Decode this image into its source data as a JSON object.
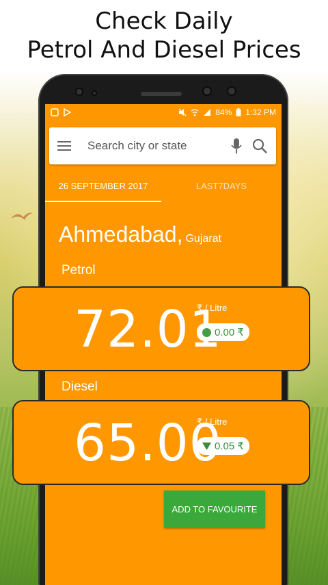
{
  "headline": {
    "line1": "Check Daily",
    "line2": "Petrol And Diesel Prices"
  },
  "statusbar": {
    "battery": "84%",
    "time": "1:32 PM"
  },
  "search": {
    "placeholder": "Search city or state"
  },
  "tabs": [
    {
      "label": "26 SEPTEMBER 2017",
      "active": true
    },
    {
      "label": "LAST7DAYS",
      "active": false
    }
  ],
  "location": {
    "city": "Ahmedabad,",
    "state": "Gujarat"
  },
  "petrol": {
    "label": "Petrol",
    "price": "72.01",
    "unit": "₹ / Litre",
    "change": "0.00 ₹",
    "change_type": "none"
  },
  "diesel": {
    "label": "Diesel",
    "price": "65.00",
    "unit": "₹ / Litre",
    "change": "0.05 ₹",
    "change_type": "down"
  },
  "actions": {
    "favourite": "ADD TO FAVOURITE"
  },
  "colors": {
    "primary": "#ff9800",
    "accent_green": "#3aa83a",
    "text_on_primary": "#ffffff"
  }
}
